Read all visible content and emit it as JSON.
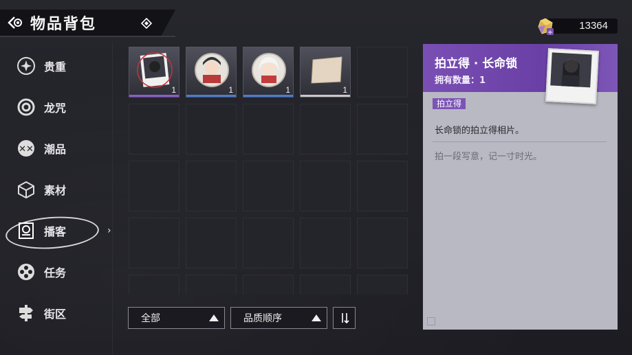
{
  "header": {
    "title": "物品背包"
  },
  "currency": {
    "amount": "13364",
    "icon": "gem-plus-icon"
  },
  "sidebar": {
    "items": [
      {
        "label": "贵重",
        "icon": "star-badge-icon"
      },
      {
        "label": "龙咒",
        "icon": "ring-icon"
      },
      {
        "label": "潮品",
        "icon": "skull-badge-icon"
      },
      {
        "label": "素材",
        "icon": "cube-icon"
      },
      {
        "label": "播客",
        "icon": "radio-icon",
        "active": true
      },
      {
        "label": "任务",
        "icon": "film-reel-icon"
      },
      {
        "label": "街区",
        "icon": "signpost-icon"
      }
    ]
  },
  "inventory": {
    "items": [
      {
        "name": "拍立得·长命锁",
        "count": "1",
        "rarity_color": "#8a5cc8",
        "selected": true
      },
      {
        "name": "badge-1",
        "count": "1",
        "rarity_color": "#4a7bd0"
      },
      {
        "name": "badge-2",
        "count": "1",
        "rarity_color": "#4a7bd0"
      },
      {
        "name": "card",
        "count": "1",
        "rarity_color": "#c8c8c8"
      }
    ]
  },
  "filters": {
    "category": "全部",
    "sort": "品质顺序"
  },
  "detail": {
    "name": "拍立得 · 长命锁",
    "owned": "拥有数量：1",
    "tag": "拍立得",
    "description": "长命锁的拍立得相片。",
    "flavor": "拍一段写意，记一寸时光。"
  },
  "colors": {
    "accent_purple": "#7a4fb4",
    "rare_blue": "#4a7bd0",
    "panel_bg": "#b9b9c3"
  }
}
